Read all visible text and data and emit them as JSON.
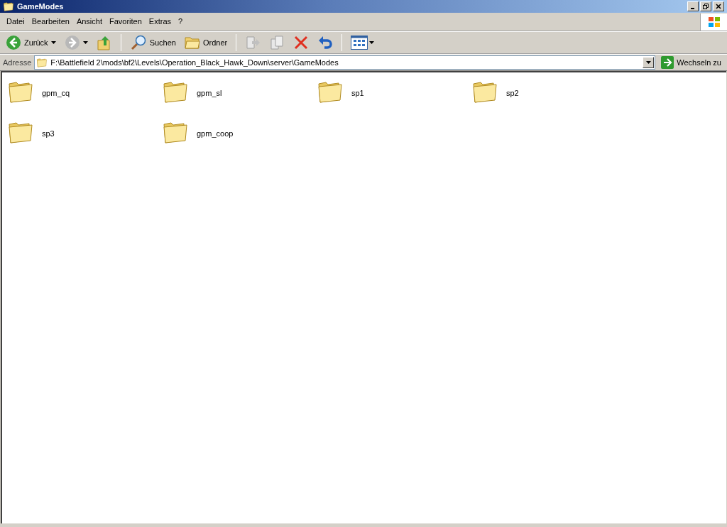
{
  "window": {
    "title": "GameModes"
  },
  "menu": [
    "Datei",
    "Bearbeiten",
    "Ansicht",
    "Favoriten",
    "Extras",
    "?"
  ],
  "toolbar": {
    "back": {
      "label": "Zurück"
    },
    "forward": {
      "disabled": true
    },
    "search": {
      "label": "Suchen"
    },
    "folders": {
      "label": "Ordner"
    },
    "move": {
      "disabled": true
    },
    "copy": {
      "disabled": true
    }
  },
  "address": {
    "label": "Adresse",
    "value": "F:\\Battlefield 2\\mods\\bf2\\Levels\\Operation_Black_Hawk_Down\\server\\GameModes",
    "go": "Wechseln zu"
  },
  "items": [
    {
      "name": "gpm_cq"
    },
    {
      "name": "gpm_sl"
    },
    {
      "name": "sp1"
    },
    {
      "name": "sp2"
    },
    {
      "name": "sp3"
    },
    {
      "name": "gpm_coop"
    }
  ]
}
